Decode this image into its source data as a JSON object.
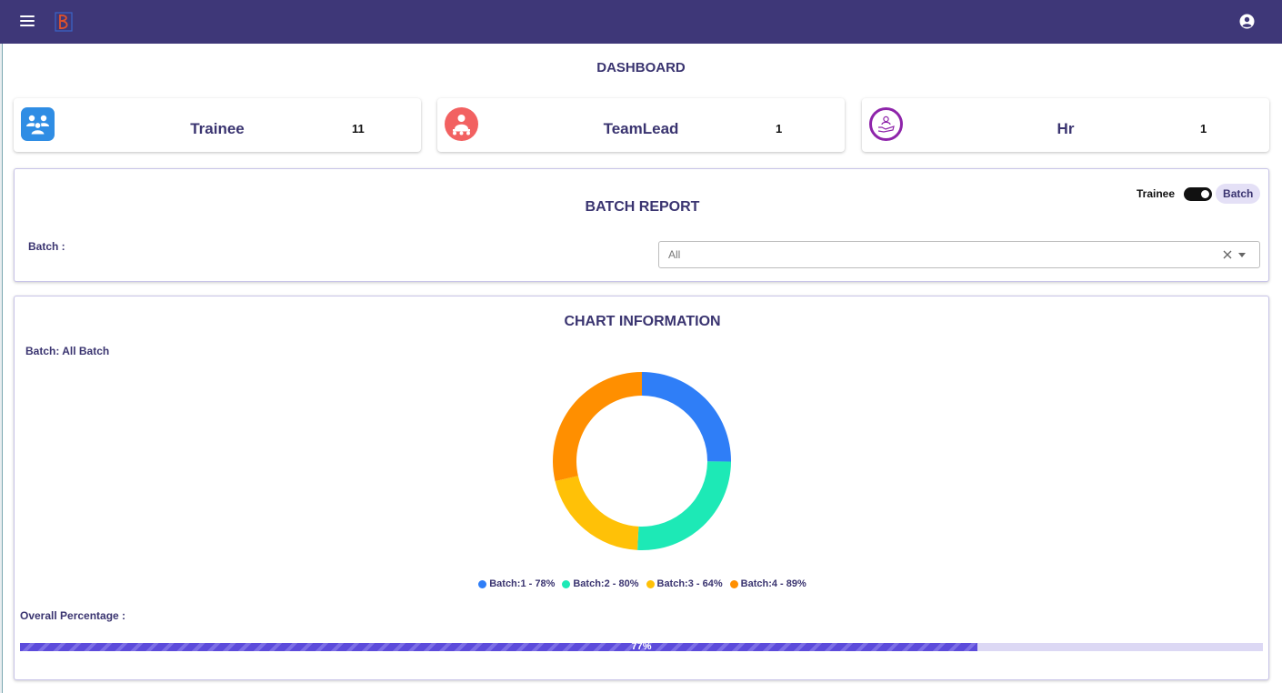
{
  "header": {
    "menu_icon": "hamburger-menu-icon",
    "logo_icon": "brand-logo-icon",
    "account_icon": "account-circle-icon"
  },
  "page_title": "DASHBOARD",
  "stats": [
    {
      "label": "Trainee",
      "count": "11",
      "icon": "group-icon",
      "color": "#2f8de4"
    },
    {
      "label": "TeamLead",
      "count": "1",
      "icon": "team-lead-icon",
      "color": "#f26161"
    },
    {
      "label": "Hr",
      "count": "1",
      "icon": "hr-icon",
      "color": "#8e24aa"
    }
  ],
  "batch_report": {
    "title": "BATCH REPORT",
    "toggle_left": "Trainee",
    "toggle_right": "Batch",
    "batch_label": "Batch :",
    "select_value": "All"
  },
  "chart_info": {
    "title": "CHART INFORMATION",
    "batch_caption": "Batch: All Batch",
    "overall_label": "Overall Percentage :",
    "overall_value": 77,
    "overall_text": "77%"
  },
  "chart_data": {
    "type": "pie",
    "donut": true,
    "categories": [
      "Batch:1",
      "Batch:2",
      "Batch:3",
      "Batch:4"
    ],
    "values": [
      78,
      80,
      64,
      89
    ],
    "legend_labels": [
      "Batch:1 - 78%",
      "Batch:2 - 80%",
      "Batch:3 - 64%",
      "Batch:4 - 89%"
    ],
    "colors": [
      "#2f7ef7",
      "#1de9b6",
      "#ffc107",
      "#ff8f00"
    ],
    "legend": "bottom"
  }
}
